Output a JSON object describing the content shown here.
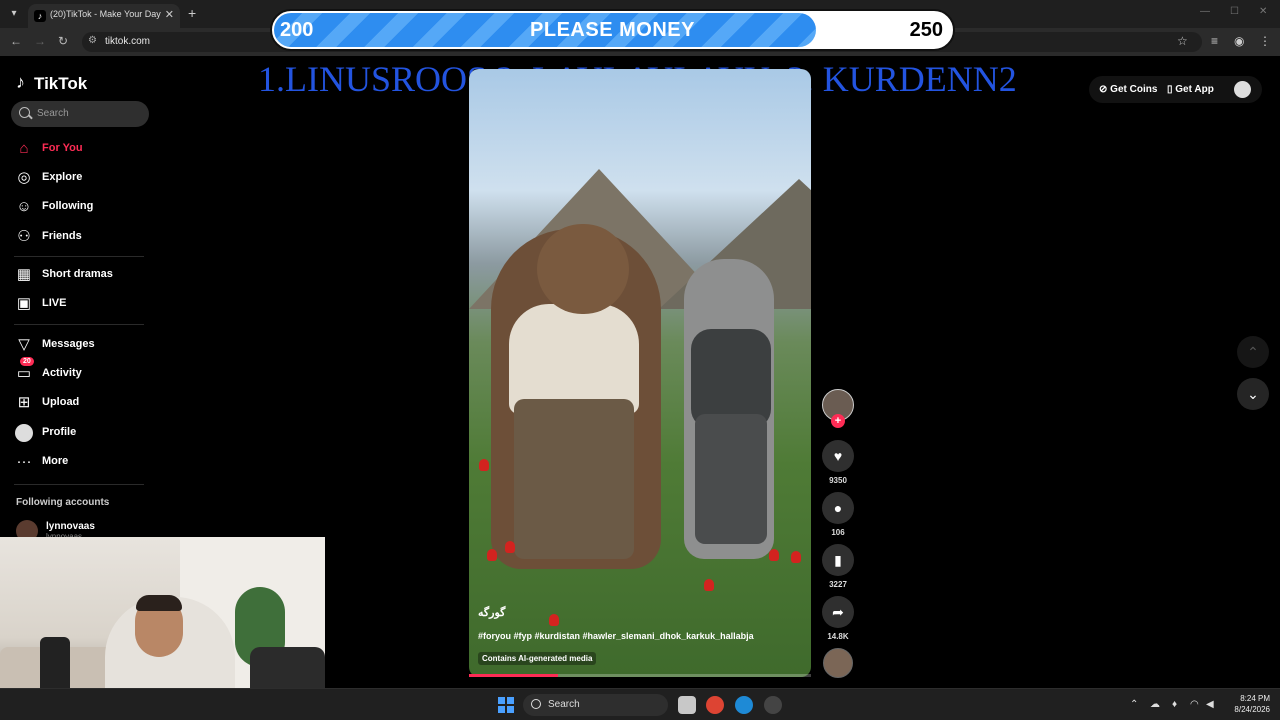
{
  "browser": {
    "tab_title": "(20)TikTok - Make Your Day",
    "tab_close": "✕",
    "new_tab": "+",
    "url": "tiktok.com",
    "win_minimize": "—",
    "win_maximize": "☐",
    "win_close": "✕"
  },
  "overlay": {
    "goal_current": "200",
    "goal_title": "PLEASE MONEY",
    "goal_target": "250",
    "goal_progress": 0.8,
    "ranking": "1.LINUSROOS 2. LAYLAYLAYY  3. KURDENN2"
  },
  "sidebar": {
    "logo": "TikTok",
    "search_placeholder": "Search",
    "items": [
      {
        "label": "For You",
        "icon": "home-icon"
      },
      {
        "label": "Explore",
        "icon": "compass-icon"
      },
      {
        "label": "Following",
        "icon": "user-follow-icon"
      },
      {
        "label": "Friends",
        "icon": "friends-icon"
      },
      {
        "label": "Short dramas",
        "icon": "film-icon"
      },
      {
        "label": "LIVE",
        "icon": "live-icon"
      },
      {
        "label": "Messages",
        "icon": "send-icon"
      },
      {
        "label": "Activity",
        "icon": "inbox-icon",
        "badge": "20"
      },
      {
        "label": "Upload",
        "icon": "plus-square-icon"
      },
      {
        "label": "Profile",
        "icon": "avatar-icon"
      },
      {
        "label": "More",
        "icon": "more-icon"
      }
    ],
    "following_title": "Following accounts",
    "following_accounts": [
      {
        "name": "lynnovaas",
        "handle": "lynnovaas"
      }
    ]
  },
  "video": {
    "author": "گورگە",
    "caption": "#foryou #fyp #kurdistan #hawler_slemani_dhok_karkuk_hallabja",
    "ai_label": "Contains AI-generated media",
    "progress": 0.26
  },
  "actions": {
    "follow_plus": "+",
    "likes": "9350",
    "comments": "106",
    "saves": "3227",
    "shares": "14.8K"
  },
  "top_right": {
    "get_coins": "Get Coins",
    "get_app": "Get App"
  },
  "taskbar": {
    "search_label": "Search",
    "time": "8:24 PM",
    "date": "8/24/2026"
  },
  "colors": {
    "accent": "#fe2c55",
    "goal_blue": "#2e8df0",
    "ranking_blue": "#2354e0"
  }
}
